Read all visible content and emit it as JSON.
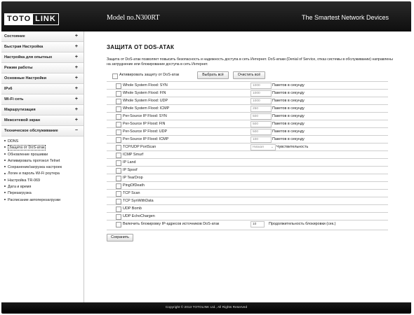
{
  "header": {
    "logo_left": "TOTO",
    "logo_right": "LINK",
    "model": "Model no.N300RT",
    "slogan": "The Smartest Network Devices"
  },
  "sidebar": {
    "items": [
      {
        "label": "Состояние",
        "toggle": "+"
      },
      {
        "label": "Быстрая Настройка",
        "toggle": "+"
      },
      {
        "label": "Настройка для опытных",
        "toggle": "+"
      },
      {
        "label": "Режим работы",
        "toggle": "+"
      },
      {
        "label": "Основные Настройки",
        "toggle": "+"
      },
      {
        "label": "IPv6",
        "toggle": "+"
      },
      {
        "label": "Wi-Fi сеть",
        "toggle": "+"
      },
      {
        "label": "Маршрутизация",
        "toggle": "+"
      },
      {
        "label": "Межсетевой экран",
        "toggle": "+"
      },
      {
        "label": "Техническое обслуживание",
        "toggle": "−"
      }
    ],
    "submenu": [
      "DDNS",
      "Защита от DoS-атак",
      "Обновление прошивки",
      "Активировать протокол Telnet",
      "Сохранение/загрузка настроек",
      "Логин и пароль Wi-Fi роутера",
      "Настройка TR-069",
      "Дата и время",
      "Перезагрузка",
      "Расписание автоперезагрузки"
    ]
  },
  "main": {
    "title": "ЗАЩИТА ОТ DOS-АТАК",
    "description": "Защита от DoS-атак позволяет повысить безопасность и надежность доступа в сеть Интернет. DoS-атаки (Denial of Service, отказ системы в обслуживании) направлены на затруднение или блокирование доступа в сеть Интернет.",
    "enable_label": "Активировать защиту от DoS-атак",
    "select_all": "Выбрать всё",
    "clear_all": "Очистить всё",
    "unit": "Пакетов в секунду",
    "flood_rows": [
      {
        "name": "Whole System Flood: SYN",
        "value": "1000"
      },
      {
        "name": "Whole System Flood: FIN",
        "value": "1000"
      },
      {
        "name": "Whole System Flood: UDP",
        "value": "1000"
      },
      {
        "name": "Whole System Flood: ICMP",
        "value": "250"
      },
      {
        "name": "Per-Source IP Flood: SYN",
        "value": "500"
      },
      {
        "name": "Per-Source IP Flood: FIN",
        "value": "500"
      },
      {
        "name": "Per-Source IP Flood: UDP",
        "value": "500"
      },
      {
        "name": "Per-Source IP Flood: ICMP",
        "value": "100"
      }
    ],
    "portscan": {
      "name": "TCP/UDP PortScan",
      "sensitivity": "Низкая",
      "sensitivity_label": "Чувствительность"
    },
    "simple_rows": [
      "ICMP Smurf",
      "IP Land",
      "IP Spoof",
      "IP TearDrop",
      "PingOfDeath",
      "TCP Scan",
      "TCP SynWithData",
      "UDP Bomb",
      "UDP EchoChargen"
    ],
    "block": {
      "name": "Включить блокировку IP-адресов источников DoS-атак",
      "value": "10",
      "label": "Продолжительность блокировки (сек.)"
    },
    "save_label": "Сохранить"
  },
  "footer": {
    "copyright": "Copyright © 2013 TOTOLINK Ltd.,   All Rights Reserved"
  }
}
